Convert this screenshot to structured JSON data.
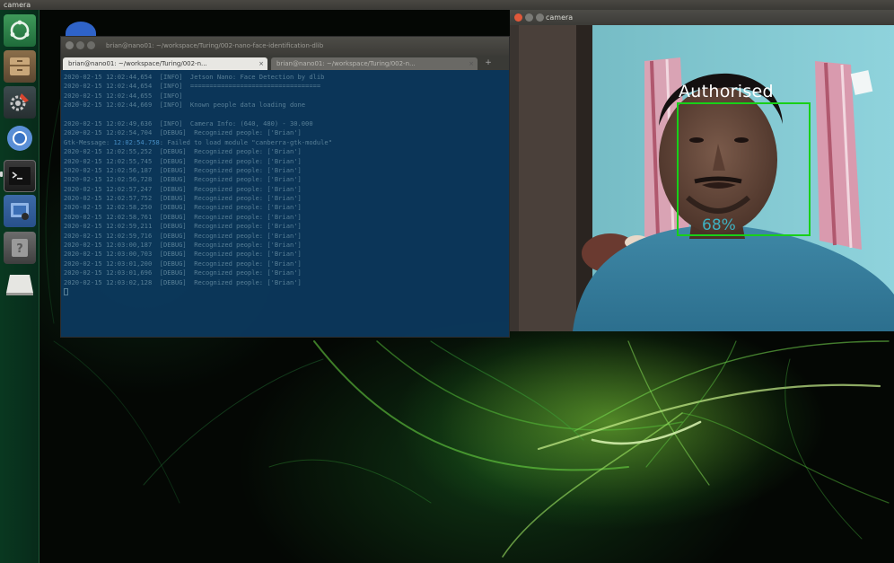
{
  "topbar": {
    "title": "camera"
  },
  "launcher": {
    "items": [
      {
        "name": "Ubuntu dash",
        "icon": "ubuntu-logo-icon"
      },
      {
        "name": "Files",
        "icon": "file-cabinet-icon"
      },
      {
        "name": "System Settings",
        "icon": "gear-wrench-icon"
      },
      {
        "name": "Chromium",
        "icon": "chromium-icon"
      },
      {
        "name": "Terminal",
        "icon": "terminal-icon"
      },
      {
        "name": "Screenshot",
        "icon": "screenshot-icon"
      },
      {
        "name": "Help",
        "icon": "help-icon"
      },
      {
        "name": "Removable drive",
        "icon": "usb-drive-icon"
      }
    ]
  },
  "terminal": {
    "title": "brian@nano01: ~/workspace/Turing/002-nano-face-identification-dlib",
    "tabs": [
      {
        "label": "brian@nano01: ~/workspace/Turing/002-n...",
        "active": true
      },
      {
        "label": "brian@nano01: ~/workspace/Turing/002-n...",
        "active": false
      }
    ],
    "lines": [
      "2020-02-15 12:02:44,654  [INFO]  Jetson Nano: Face Detection by dlib",
      "2020-02-15 12:02:44,654  [INFO]  ==================================",
      "2020-02-15 12:02:44,655  [INFO]",
      "2020-02-15 12:02:44,669  [INFO]  Known people data loading done",
      "",
      "2020-02-15 12:02:49,636  [INFO]  Camera Info: (640, 480) - 30.000",
      "2020-02-15 12:02:54,704  [DEBUG]  Recognized people: ['Brian']",
      "Gtk-Message: 12:02:54.758: Failed to load module \"canberra-gtk-module\"",
      "2020-02-15 12:02:55,252  [DEBUG]  Recognized people: ['Brian']",
      "2020-02-15 12:02:55,745  [DEBUG]  Recognized people: ['Brian']",
      "2020-02-15 12:02:56,187  [DEBUG]  Recognized people: ['Brian']",
      "2020-02-15 12:02:56,728  [DEBUG]  Recognized people: ['Brian']",
      "2020-02-15 12:02:57,247  [DEBUG]  Recognized people: ['Brian']",
      "2020-02-15 12:02:57,752  [DEBUG]  Recognized people: ['Brian']",
      "2020-02-15 12:02:58,250  [DEBUG]  Recognized people: ['Brian']",
      "2020-02-15 12:02:58,761  [DEBUG]  Recognized people: ['Brian']",
      "2020-02-15 12:02:59,211  [DEBUG]  Recognized people: ['Brian']",
      "2020-02-15 12:02:59,716  [DEBUG]  Recognized people: ['Brian']",
      "2020-02-15 12:03:00,187  [DEBUG]  Recognized people: ['Brian']",
      "2020-02-15 12:03:00,703  [DEBUG]  Recognized people: ['Brian']",
      "2020-02-15 12:03:01,200  [DEBUG]  Recognized people: ['Brian']",
      "2020-02-15 12:03:01,696  [DEBUG]  Recognized people: ['Brian']",
      "2020-02-15 12:03:02,128  [DEBUG]  Recognized people: ['Brian']"
    ],
    "gtk_time": "12:02:54.758"
  },
  "camera": {
    "title": "camera",
    "label": "Authorised",
    "confidence": "68%",
    "box_color": "#18d018"
  },
  "colors": {
    "accent_green": "#18d018",
    "terminal_bg": "#0c3a5f",
    "close_button": "#e0583a"
  }
}
